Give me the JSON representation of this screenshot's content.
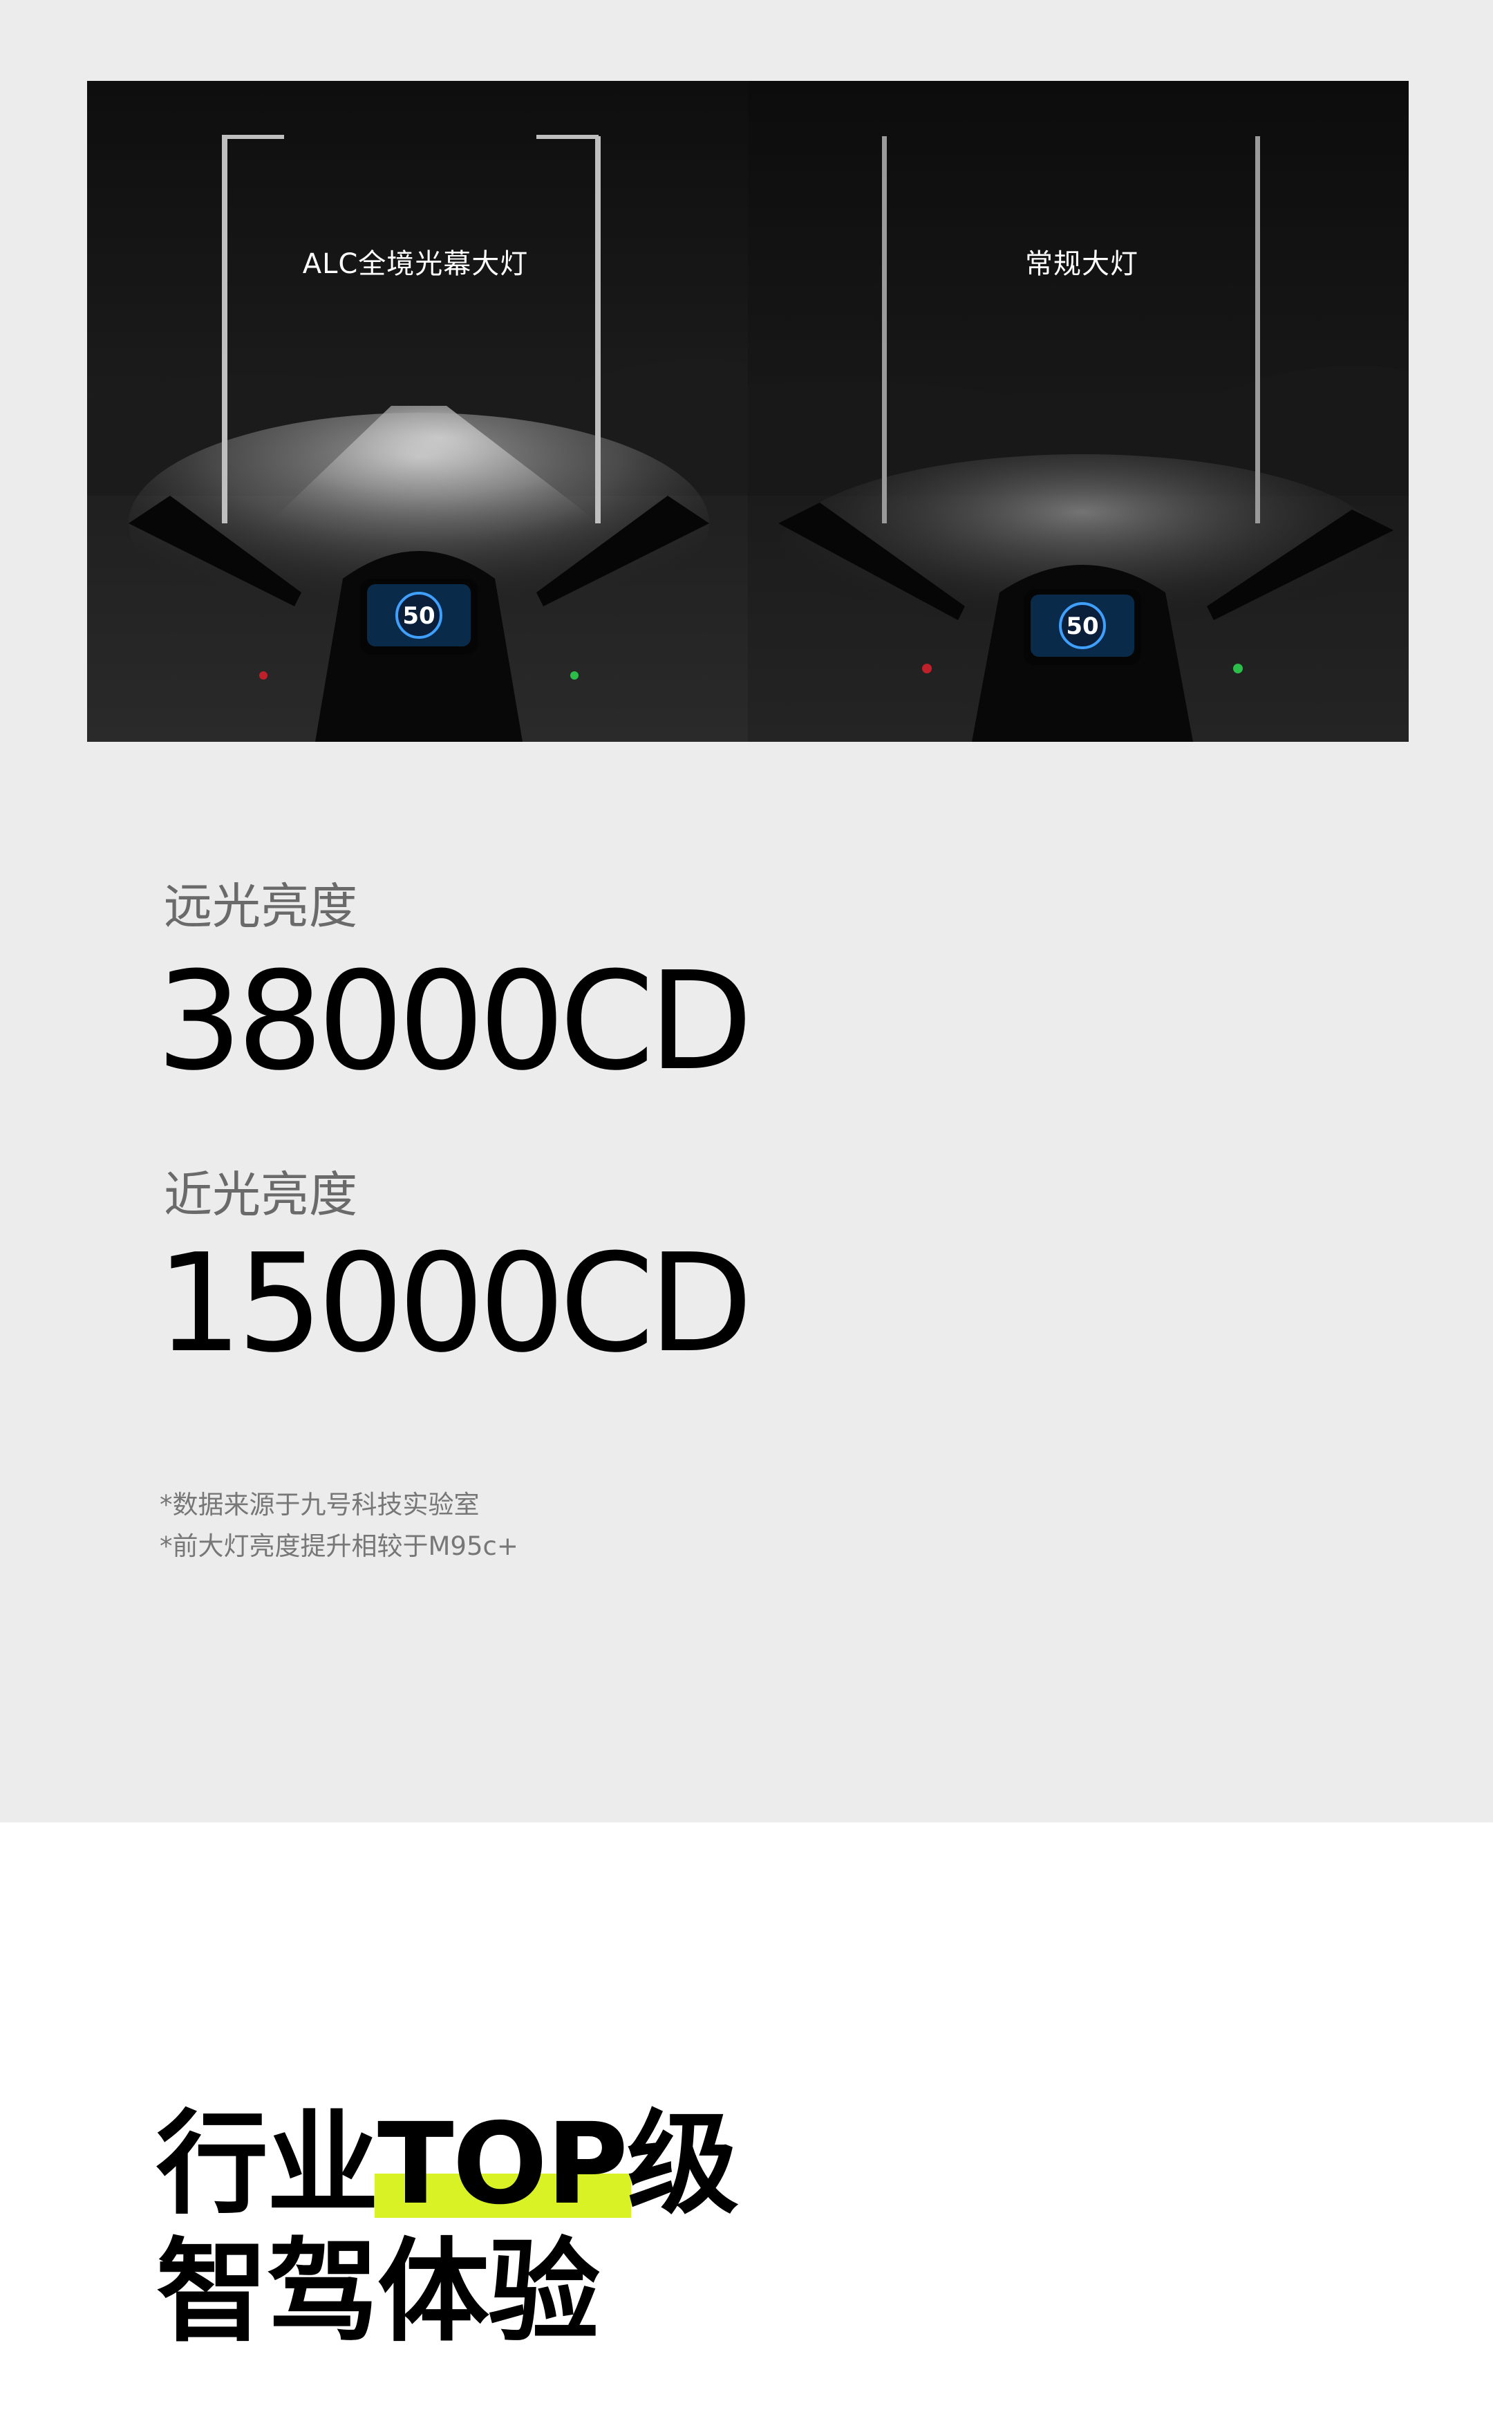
{
  "comparison": {
    "left_label": "ALC全境光幕大灯",
    "right_label": "常规大灯",
    "speed_readout": "50"
  },
  "metrics": {
    "high_beam": {
      "label": "远光亮度",
      "value": "38000CD"
    },
    "low_beam": {
      "label": "近光亮度",
      "value": "15000CD"
    }
  },
  "footnotes": [
    "*数据来源于九号科技实验室",
    "*前大灯亮度提升相较于M95c+"
  ],
  "headline": {
    "line1_prefix": "行业",
    "line1_highlight": "TOP",
    "line1_suffix": "级",
    "line2": "智驾体验"
  },
  "colors": {
    "top_background": "#ececec",
    "bottom_background": "#ffffff",
    "highlight": "#d9f226",
    "label_gray": "#6a6a6a"
  }
}
